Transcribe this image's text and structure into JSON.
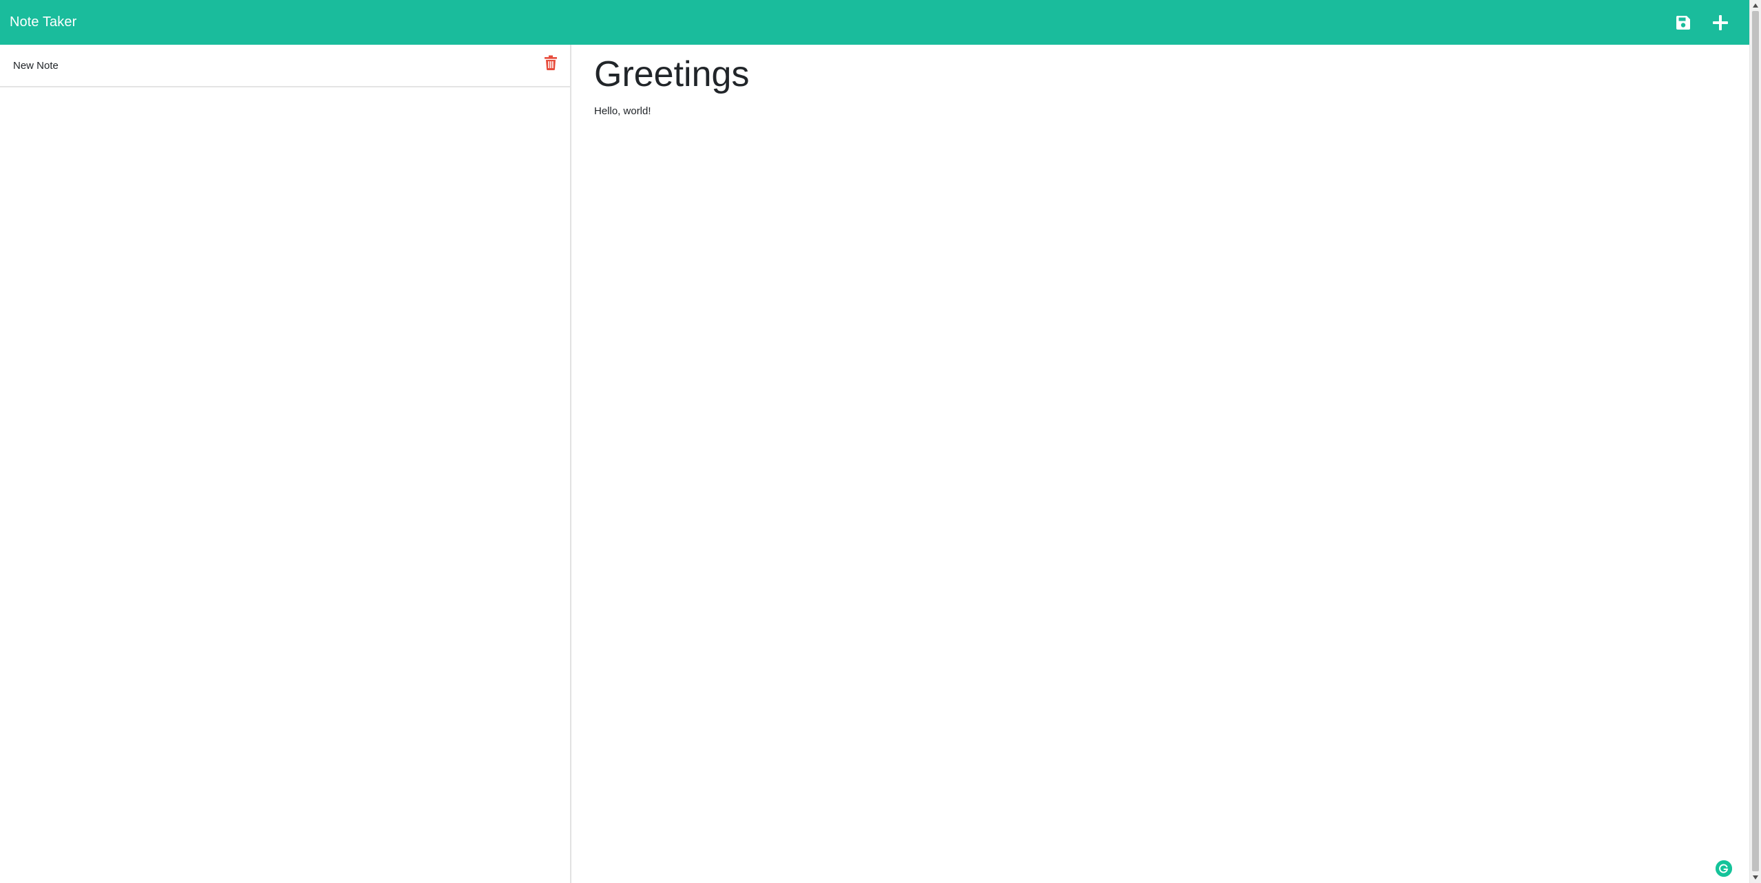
{
  "navbar": {
    "brand": "Note Taker",
    "actions": [
      {
        "icon": "save-icon"
      },
      {
        "icon": "plus-icon"
      }
    ],
    "background_color": "#1abc9c"
  },
  "sidebar": {
    "notes": [
      {
        "title": "New Note",
        "delete_icon": "trash-icon",
        "delete_color": "#e74c3c"
      }
    ]
  },
  "editor": {
    "title": "Greetings",
    "text": "Hello, world!"
  },
  "extensions": {
    "grammarly_icon": "grammarly-icon"
  }
}
